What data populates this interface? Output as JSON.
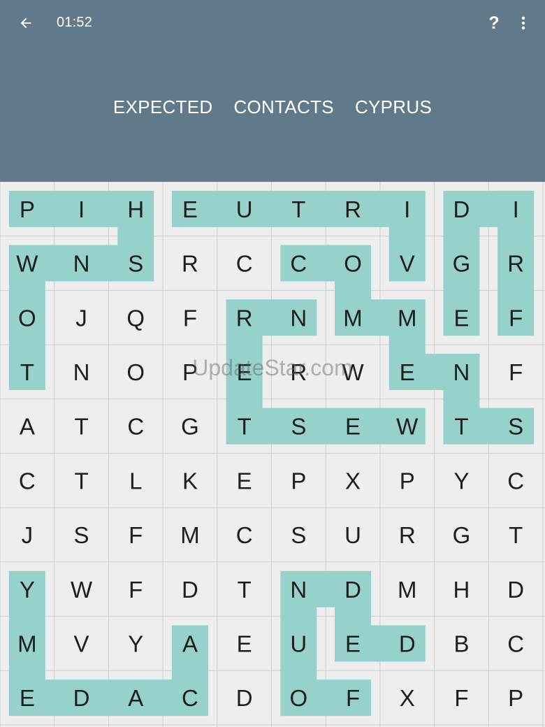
{
  "header": {
    "timer": "01:52",
    "help_label": "?",
    "back_icon": "arrow-left-icon",
    "menu_icon": "more-vertical-icon",
    "background_color": "#607a89"
  },
  "words": [
    "EXPECTED",
    "CONTACTS",
    "CYPRUS"
  ],
  "watermark": "UpdateStar.com",
  "highlight_color": "#96d1cc",
  "grid": [
    [
      "P",
      "I",
      "H",
      "E",
      "U",
      "T",
      "R",
      "I",
      "D",
      "I"
    ],
    [
      "W",
      "N",
      "S",
      "R",
      "C",
      "C",
      "O",
      "V",
      "G",
      "R"
    ],
    [
      "O",
      "J",
      "Q",
      "F",
      "R",
      "N",
      "M",
      "M",
      "E",
      "F"
    ],
    [
      "T",
      "N",
      "O",
      "P",
      "E",
      "R",
      "W",
      "E",
      "N",
      "F"
    ],
    [
      "A",
      "T",
      "C",
      "G",
      "T",
      "S",
      "E",
      "W",
      "T",
      "S"
    ],
    [
      "C",
      "T",
      "L",
      "K",
      "E",
      "P",
      "X",
      "P",
      "Y",
      "C"
    ],
    [
      "J",
      "S",
      "F",
      "M",
      "C",
      "S",
      "U",
      "R",
      "G",
      "T"
    ],
    [
      "Y",
      "W",
      "F",
      "D",
      "T",
      "N",
      "D",
      "M",
      "H",
      "D"
    ],
    [
      "M",
      "V",
      "Y",
      "A",
      "E",
      "U",
      "E",
      "D",
      "B",
      "C"
    ],
    [
      "E",
      "D",
      "A",
      "C",
      "D",
      "O",
      "F",
      "X",
      "F",
      "P"
    ]
  ],
  "found_paths": [
    [
      [
        3,
        0
      ],
      [
        2,
        0
      ],
      [
        1,
        0
      ],
      [
        1,
        1
      ],
      [
        1,
        2
      ],
      [
        0,
        2
      ],
      [
        0,
        1
      ],
      [
        0,
        0
      ]
    ],
    [
      [
        0,
        3
      ],
      [
        0,
        4
      ],
      [
        0,
        5
      ],
      [
        0,
        6
      ],
      [
        0,
        7
      ],
      [
        1,
        7
      ]
    ],
    [
      [
        0,
        9
      ],
      [
        0,
        8
      ],
      [
        1,
        8
      ],
      [
        2,
        8
      ]
    ],
    [
      [
        0,
        9
      ],
      [
        1,
        9
      ],
      [
        2,
        9
      ]
    ],
    [
      [
        2,
        5
      ],
      [
        2,
        4
      ],
      [
        3,
        4
      ],
      [
        4,
        4
      ],
      [
        4,
        5
      ],
      [
        4,
        6
      ],
      [
        4,
        7
      ]
    ],
    [
      [
        1,
        5
      ],
      [
        1,
        6
      ],
      [
        2,
        6
      ],
      [
        2,
        7
      ],
      [
        3,
        7
      ],
      [
        3,
        8
      ],
      [
        4,
        8
      ],
      [
        4,
        9
      ]
    ],
    [
      [
        7,
        0
      ],
      [
        8,
        0
      ],
      [
        9,
        0
      ],
      [
        9,
        1
      ],
      [
        9,
        2
      ],
      [
        9,
        3
      ],
      [
        8,
        3
      ]
    ],
    [
      [
        9,
        6
      ],
      [
        9,
        5
      ],
      [
        8,
        5
      ],
      [
        7,
        5
      ],
      [
        7,
        6
      ],
      [
        8,
        6
      ],
      [
        8,
        7
      ]
    ]
  ]
}
